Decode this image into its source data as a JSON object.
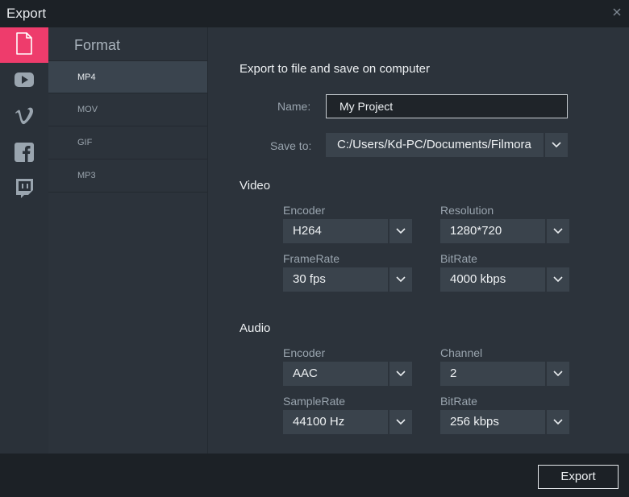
{
  "window": {
    "title": "Export"
  },
  "destinations": [
    {
      "name": "computer-file",
      "icon": "file-icon"
    },
    {
      "name": "youtube",
      "icon": "youtube-icon"
    },
    {
      "name": "vimeo",
      "icon": "vimeo-icon"
    },
    {
      "name": "facebook",
      "icon": "facebook-icon"
    },
    {
      "name": "twitch",
      "icon": "twitch-icon"
    }
  ],
  "format": {
    "header": "Format",
    "items": [
      "MP4",
      "MOV",
      "GIF",
      "MP3"
    ],
    "selected": "MP4"
  },
  "main": {
    "heading": "Export to file and save on computer",
    "name_label": "Name:",
    "name_value": "My Project",
    "saveto_label": "Save to:",
    "saveto_value": "C:/Users/Kd-PC/Documents/Filmora"
  },
  "video": {
    "heading": "Video",
    "encoder_label": "Encoder",
    "encoder_value": "H264",
    "resolution_label": "Resolution",
    "resolution_value": "1280*720",
    "framerate_label": "FrameRate",
    "framerate_value": "30 fps",
    "bitrate_label": "BitRate",
    "bitrate_value": "4000 kbps"
  },
  "audio": {
    "heading": "Audio",
    "encoder_label": "Encoder",
    "encoder_value": "AAC",
    "channel_label": "Channel",
    "channel_value": "2",
    "samplerate_label": "SampleRate",
    "samplerate_value": "44100 Hz",
    "bitrate_label": "BitRate",
    "bitrate_value": "256 kbps"
  },
  "footer": {
    "export_label": "Export"
  },
  "colors": {
    "accent": "#ee3c6c",
    "panel": "#2c333b",
    "dark": "#1c2126"
  }
}
